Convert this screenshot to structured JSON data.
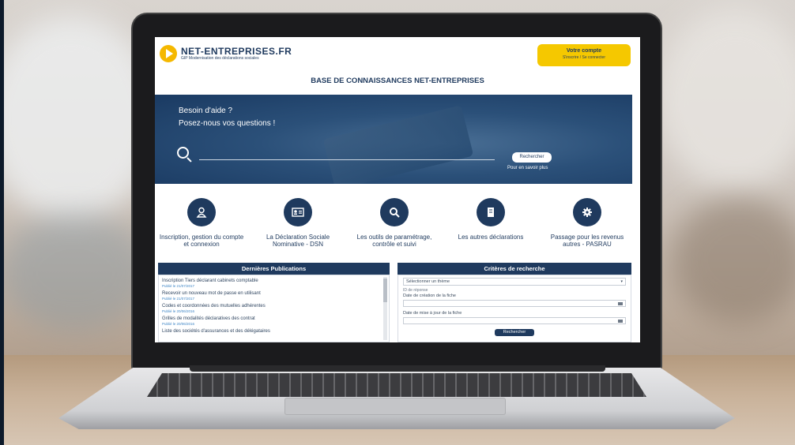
{
  "header": {
    "logo_name": "NET-ENTREPRISES.FR",
    "logo_subtitle": "GIP Modernisation des déclarations sociales",
    "account_title": "Votre compte",
    "account_sub": "S'inscrire / Se connecter",
    "page_title": "BASE DE CONNAISSANCES NET-ENTREPRISES"
  },
  "hero": {
    "line1": "Besoin d'aide ?",
    "line2": "Posez-nous vos questions !",
    "search_button": "Rechercher",
    "more_link": "Pour en savoir plus"
  },
  "categories": [
    {
      "label": "Inscription, gestion du compte et connexion",
      "icon": "user-icon"
    },
    {
      "label": "La Déclaration Sociale Nominative - DSN",
      "icon": "id-card-icon"
    },
    {
      "label": "Les outils de paramétrage, contrôle et suivi",
      "icon": "search-icon"
    },
    {
      "label": "Les autres déclarations",
      "icon": "document-icon"
    },
    {
      "label": "Passage pour les revenus autres - PASRAU",
      "icon": "gear-icon"
    }
  ],
  "publications": {
    "title": "Dernières Publications",
    "items": [
      {
        "title": "Inscription Tiers déclarant cabinets comptable",
        "date": "Publié le 21/07/2017"
      },
      {
        "title": "Recevoir un nouveau mot de passe en utilisant",
        "date": "Publié le 21/07/2017"
      },
      {
        "title": "Codes et coordonnées des mutuelles adhérentes",
        "date": "Publié le 20/06/2016"
      },
      {
        "title": "Grilles de modalités déclaratives des contrat",
        "date": "Publié le 20/06/2016"
      },
      {
        "title": "Liste des sociétés d'assurances et des délégataires",
        "date": ""
      }
    ]
  },
  "criteria": {
    "title": "Critères de recherche",
    "theme_select": "Sélectionner un thème",
    "id_label": "ID de réponse",
    "created_label": "Date de création de la fiche",
    "updated_label": "Date de mise à jour de la fiche",
    "search_button": "Rechercher"
  },
  "colors": {
    "brand_navy": "#1f3a5e",
    "brand_yellow": "#f5c800"
  }
}
